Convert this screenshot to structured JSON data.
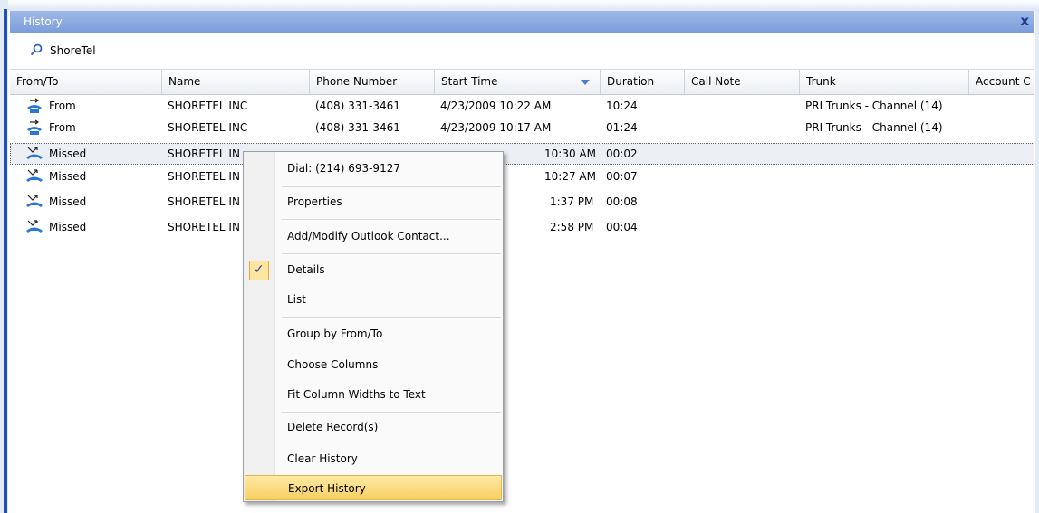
{
  "window": {
    "title": "History",
    "close_label": "x"
  },
  "search": {
    "value": "ShoreTel",
    "icon": "search-icon"
  },
  "columns": [
    "From/To",
    "Name",
    "Phone Number",
    "Start Time",
    "Duration",
    "Call Note",
    "Trunk",
    "Account C"
  ],
  "rows": [
    {
      "direction": "From",
      "icon": "outgoing-call-icon",
      "name": "SHORETEL INC",
      "phone": "(408) 331-3461",
      "start": "4/23/2009 10:22 AM",
      "duration": "10:24",
      "note": "",
      "trunk": "PRI Trunks - Channel (14)"
    },
    {
      "direction": "From",
      "icon": "outgoing-call-icon",
      "name": "SHORETEL INC",
      "phone": "(408) 331-3461",
      "start": "4/23/2009 10:17 AM",
      "duration": "01:24",
      "note": "",
      "trunk": "PRI Trunks - Channel (14)"
    },
    {
      "direction": "Missed",
      "icon": "missed-call-icon",
      "name": "SHORETEL IN",
      "phone": "",
      "start": "10:30 AM",
      "duration": "00:02",
      "note": "",
      "trunk": ""
    },
    {
      "direction": "Missed",
      "icon": "missed-call-icon",
      "name": "SHORETEL IN",
      "phone": "",
      "start": "10:27 AM",
      "duration": "00:07",
      "note": "",
      "trunk": ""
    },
    {
      "direction": "Missed",
      "icon": "missed-call-icon",
      "name": "SHORETEL IN",
      "phone": "",
      "start": "1:37 PM",
      "duration": "00:08",
      "note": "",
      "trunk": ""
    },
    {
      "direction": "Missed",
      "icon": "missed-call-icon",
      "name": "SHORETEL IN",
      "phone": "",
      "start": "2:58 PM",
      "duration": "00:04",
      "note": "",
      "trunk": ""
    }
  ],
  "context_menu": {
    "items": [
      {
        "label": "Dial: (214) 693-9127"
      },
      {
        "label": "Properties"
      },
      {
        "label": "Add/Modify Outlook Contact..."
      },
      {
        "label": "Details",
        "checked": true
      },
      {
        "label": "List"
      },
      {
        "label": "Group by From/To"
      },
      {
        "label": "Choose Columns"
      },
      {
        "label": "Fit Column Widths to Text"
      },
      {
        "label": "Delete Record(s)"
      },
      {
        "label": "Clear History"
      },
      {
        "label": "Export History",
        "highlighted": true
      }
    ],
    "check_mark": "✓"
  },
  "colors": {
    "titlebar": "#8aa8e2",
    "accent": "#2151b8",
    "menu_highlight": "#f9cf61"
  }
}
